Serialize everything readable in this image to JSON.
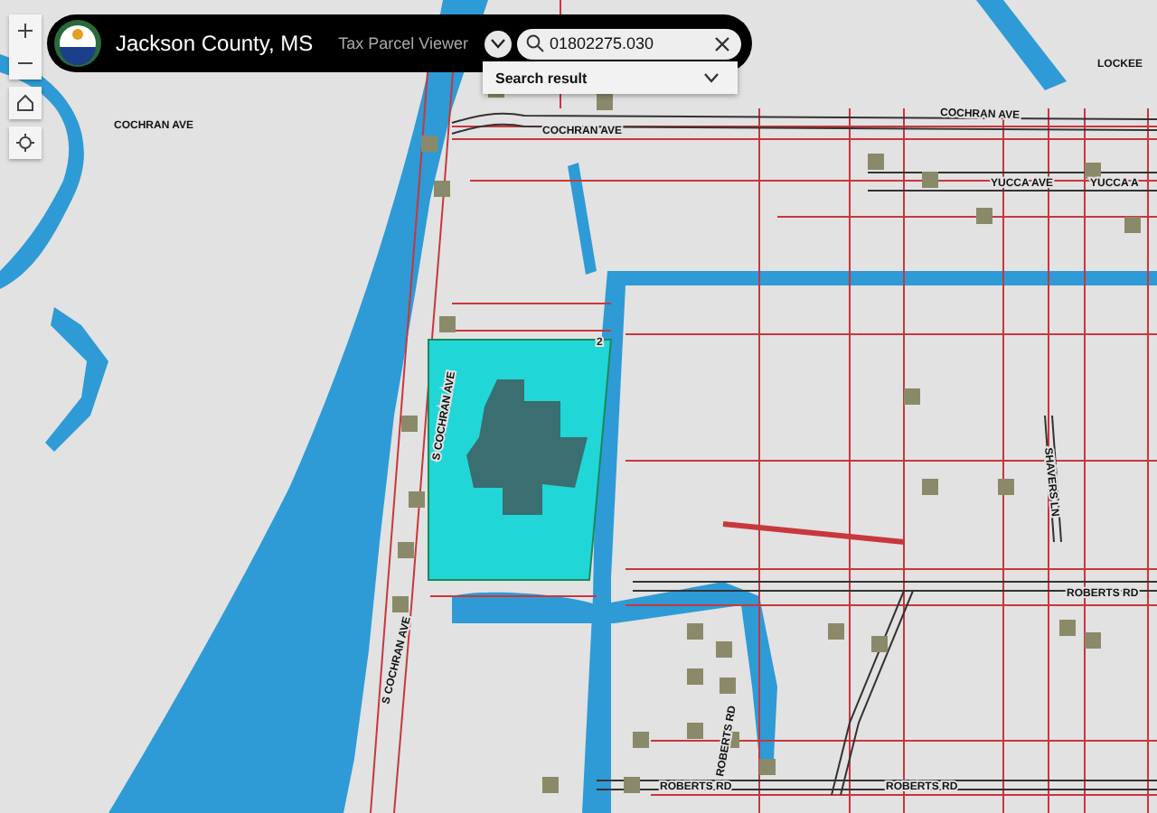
{
  "header": {
    "title": "Jackson County, MS",
    "subtitle": "Tax Parcel Viewer"
  },
  "search": {
    "value": "01802275.030"
  },
  "search_result": {
    "label": "Search result",
    "expanded": false
  },
  "map": {
    "parcel_label": "2",
    "street_labels": [
      {
        "text": "COCHRAN AVE"
      },
      {
        "text": "COCHRAN AVE"
      },
      {
        "text": "COCHRAN AVE"
      },
      {
        "text": "LOCKEE"
      },
      {
        "text": "YUCCA AVE"
      },
      {
        "text": "YUCCA A"
      },
      {
        "text": "S COCHRAN AVE"
      },
      {
        "text": "S COCHRAN AVE"
      },
      {
        "text": "SHAVERS LN"
      },
      {
        "text": "ROBERTS RD"
      },
      {
        "text": "ROBERTS RD"
      },
      {
        "text": "ROBERTS RD"
      },
      {
        "text": "ROBERTS RD"
      }
    ]
  }
}
